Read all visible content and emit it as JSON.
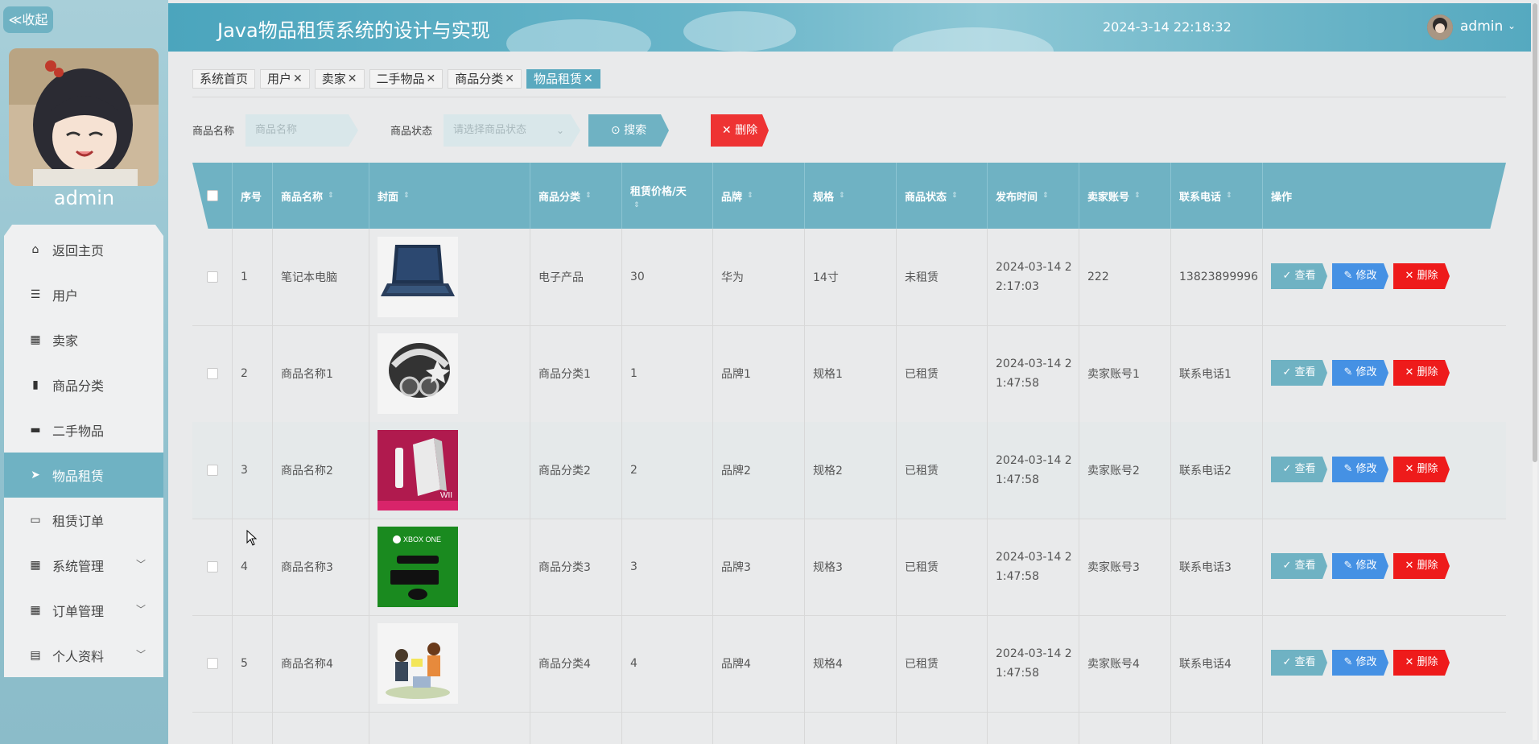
{
  "sidebar": {
    "collapse_label": "≪收起",
    "username": "admin",
    "items": [
      {
        "icon": "home-icon",
        "label": "返回主页"
      },
      {
        "icon": "list-icon",
        "label": "用户"
      },
      {
        "icon": "grid-icon",
        "label": "卖家"
      },
      {
        "icon": "bar-chart-icon",
        "label": "商品分类"
      },
      {
        "icon": "chat-icon",
        "label": "二手物品"
      },
      {
        "icon": "send-icon",
        "label": "物品租赁"
      },
      {
        "icon": "monitor-icon",
        "label": "租赁订单"
      },
      {
        "icon": "grid-icon",
        "label": "系统管理"
      },
      {
        "icon": "grid-icon",
        "label": "订单管理"
      },
      {
        "icon": "card-icon",
        "label": "个人资料"
      }
    ],
    "active_index": 5
  },
  "header": {
    "title": "Java物品租赁系统的设计与实现",
    "datetime": "2024-3-14 22:18:32",
    "user": "admin"
  },
  "tabs": [
    {
      "label": "系统首页",
      "closable": false
    },
    {
      "label": "用户",
      "closable": true
    },
    {
      "label": "卖家",
      "closable": true
    },
    {
      "label": "二手物品",
      "closable": true
    },
    {
      "label": "商品分类",
      "closable": true
    },
    {
      "label": "物品租赁",
      "closable": true,
      "active": true
    }
  ],
  "search": {
    "name_label": "商品名称",
    "name_placeholder": "商品名称",
    "status_label": "商品状态",
    "status_placeholder": "请选择商品状态",
    "search_button": "搜索",
    "delete_button": "删除"
  },
  "table": {
    "columns": [
      "序号",
      "商品名称",
      "封面",
      "商品分类",
      "租赁价格/天",
      "品牌",
      "规格",
      "商品状态",
      "发布时间",
      "卖家账号",
      "联系电话",
      "操作"
    ],
    "rows": [
      {
        "no": "1",
        "name": "笔记本电脑",
        "cover": "laptop",
        "category": "电子产品",
        "price": "30",
        "brand": "华为",
        "spec": "14寸",
        "status": "未租赁",
        "time1": "2024-03-14 2",
        "time2": "2:17:03",
        "seller": "222",
        "phone": "13823899996"
      },
      {
        "no": "2",
        "name": "商品名称1",
        "cover": "helmet",
        "category": "商品分类1",
        "price": "1",
        "brand": "品牌1",
        "spec": "规格1",
        "status": "已租赁",
        "time1": "2024-03-14 2",
        "time2": "1:47:58",
        "seller": "卖家账号1",
        "phone": "联系电话1"
      },
      {
        "no": "3",
        "name": "商品名称2",
        "cover": "wii",
        "category": "商品分类2",
        "price": "2",
        "brand": "品牌2",
        "spec": "规格2",
        "status": "已租赁",
        "time1": "2024-03-14 2",
        "time2": "1:47:58",
        "seller": "卖家账号2",
        "phone": "联系电话2"
      },
      {
        "no": "4",
        "name": "商品名称3",
        "cover": "xbox",
        "category": "商品分类3",
        "price": "3",
        "brand": "品牌3",
        "spec": "规格3",
        "status": "已租赁",
        "time1": "2024-03-14 2",
        "time2": "1:47:58",
        "seller": "卖家账号3",
        "phone": "联系电话3"
      },
      {
        "no": "5",
        "name": "商品名称4",
        "cover": "kids",
        "category": "商品分类4",
        "price": "4",
        "brand": "品牌4",
        "spec": "规格4",
        "status": "已租赁",
        "time1": "2024-03-14 2",
        "time2": "1:47:58",
        "seller": "卖家账号4",
        "phone": "联系电话4"
      }
    ],
    "actions": {
      "view": "查看",
      "edit": "修改",
      "delete": "删除"
    },
    "wii_text": "WII",
    "xbox_text": "XBOX ONE"
  },
  "colors": {
    "accent": "#6fb2c3",
    "edit": "#4591e4",
    "danger": "#ee1b1b"
  }
}
